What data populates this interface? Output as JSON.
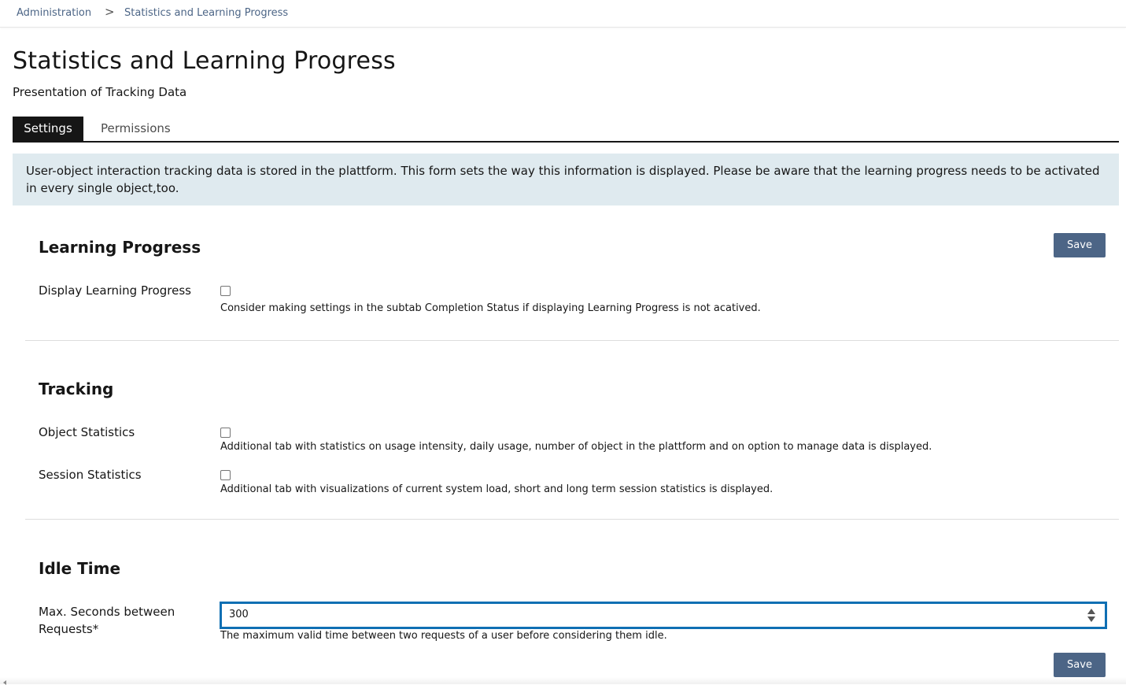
{
  "breadcrumb": {
    "items": [
      "Administration",
      "Statistics and Learning Progress"
    ],
    "separator": ">"
  },
  "page": {
    "title": "Statistics and Learning Progress",
    "subtitle": "Presentation of Tracking Data"
  },
  "tabs": [
    {
      "label": "Settings",
      "active": true
    },
    {
      "label": "Permissions",
      "active": false
    }
  ],
  "info": {
    "text": "User-object interaction tracking data is stored in the plattform. This form sets the way this information is displayed. Please be aware that the learning progress needs to be activated in every single object,too."
  },
  "save_label": "Save",
  "sections": {
    "learning_progress": {
      "title": "Learning Progress",
      "display": {
        "label": "Display Learning Progress",
        "checked": false,
        "help": "Consider making settings in the subtab Completion Status if displaying Learning Progress is not acatived."
      }
    },
    "tracking": {
      "title": "Tracking",
      "object_statistics": {
        "label": "Object Statistics",
        "checked": false,
        "help": "Additional tab with statistics on usage intensity, daily usage, number of object in the plattform and on option to manage data is displayed."
      },
      "session_statistics": {
        "label": "Session Statistics",
        "checked": false,
        "help": "Additional tab with visualizations of current system load, short and long term session statistics is displayed."
      }
    },
    "idle_time": {
      "title": "Idle Time",
      "max_seconds": {
        "label": "Max. Seconds between Requests*",
        "value": "300",
        "help": "The maximum valid time between two requests of a user before considering them idle."
      }
    }
  },
  "colors": {
    "primary_button": "#4c6586",
    "focus_border": "#0f6fb3",
    "info_background": "#dfeaef",
    "active_tab": "#161616"
  }
}
